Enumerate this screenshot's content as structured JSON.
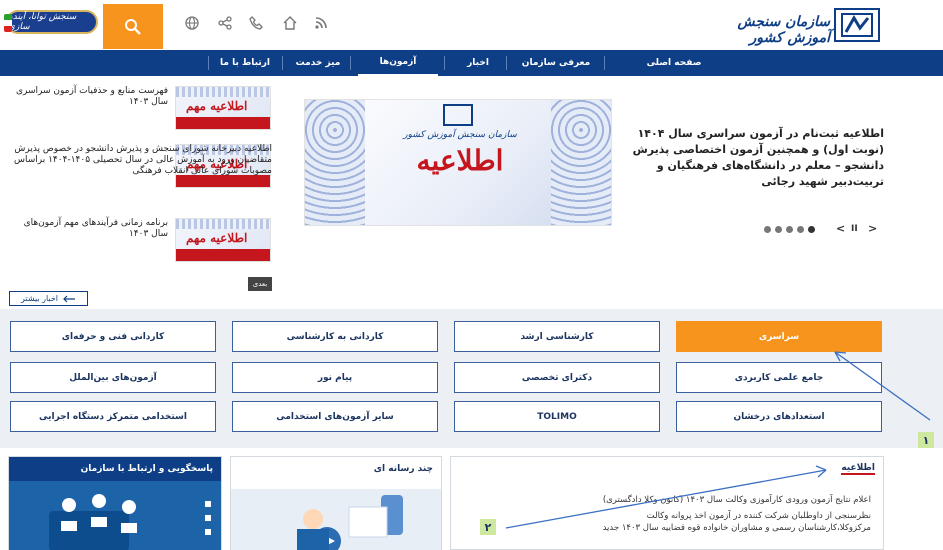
{
  "header": {
    "site_title": "سازمان سنجش آموزش کشور",
    "slogan": "سنجش توانا، آینده سازی",
    "icons": [
      "rss-icon",
      "home-icon",
      "phone-icon",
      "share-icon",
      "globe-icon"
    ]
  },
  "nav": {
    "items": [
      {
        "label": "صفحه اصلی"
      },
      {
        "label": "معرفی سازمان"
      },
      {
        "label": "اخبار"
      },
      {
        "label": "آزمون‌ها"
      },
      {
        "label": "میز خدمت"
      },
      {
        "label": "ارتباط با ما"
      }
    ]
  },
  "side_news": [
    {
      "title": "فهرست منابع و حذفیات آزمون سراسری سال ۱۴۰۳",
      "thumb": "اطلاعیه مهم"
    },
    {
      "title": "اطلاعیه دبیرخانه شورای سنجش و پذیرش دانشجو در خصوص پذیرش متقاضیان ورود به آموزش عالی در سال تحصیلی ۱۴۰۵-۱۴۰۴ براساس مصوبات شورای عالی انقلاب فرهنگی",
      "thumb": "اطلاعیه مهم"
    },
    {
      "title": "برنامه زمانی فرآیندهای مهم آزمون‌های سال ۱۴۰۳",
      "thumb": "اطلاعیه مهم"
    }
  ],
  "slider": {
    "image_subtitle": "سازمان سنجش آموزش کشور",
    "image_title": "اطلاعیه",
    "headline": "اطلاعیه ثبت‌نام در آزمون سراسری سال ۱۴۰۴ (نوبت اول) و همچنین آزمون اختصاصی پذیرش دانشجو – معلم در دانشگاه‌های فرهنگیان و تربیت‌دبیر شهید رجائی",
    "prev": "<",
    "pause": "II",
    "next": ">"
  },
  "buttons": {
    "next_label": "بعدی",
    "more_news": "اخبار بیشتر"
  },
  "exams": [
    [
      "سراسری",
      "کارشناسی ارشد",
      "کاردانی به کارشناسی",
      "کاردانی فنی و حرفه‌ای"
    ],
    [
      "جامع علمی کاربردی",
      "دکترای تخصصی",
      "پیام نور",
      "آزمون‌های بین‌الملل"
    ],
    [
      "استعدادهای درخشان",
      "TOLIMO",
      "سایر آزمون‌های استخدامی",
      "استخدامی متمرکز دستگاه اجرایی"
    ]
  ],
  "boxes": {
    "announcements_title": "اطلاعیه",
    "media_title": "چند رسانه ای",
    "contact_title": "پاسخگویی و ارتباط با سازمان",
    "news_lines": [
      "اعلام نتایج آزمون ورودی کارآموزی وکالت سال ۱۴۰۳ (کانون وکلا دادگستری)",
      "نظرسنجی از داوطلبان شرکت کننده در آزمون اخذ پروانه وکالت",
      "مرکزوکلا،کارشناسان رسمی و مشاوران خانواده قوه قضاییه سال ۱۴۰۳ جدید"
    ]
  },
  "annotations": {
    "label_1": "۱",
    "label_2": "۲"
  }
}
